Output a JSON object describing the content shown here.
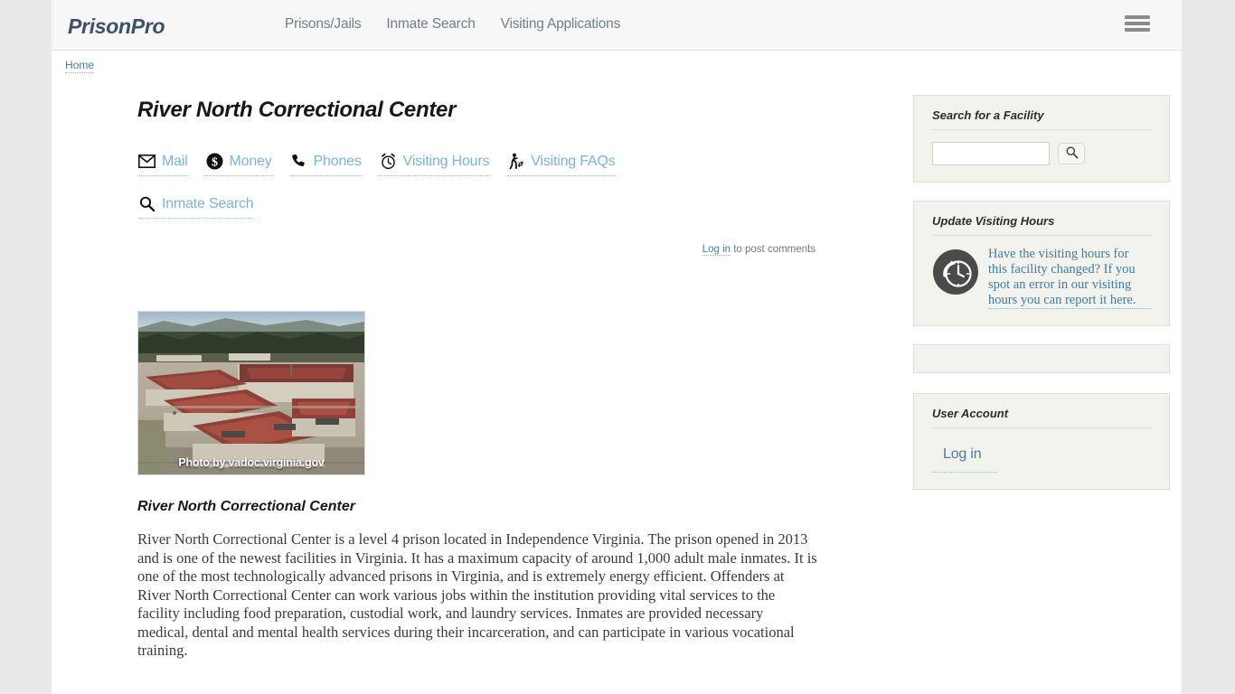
{
  "header": {
    "brand": "PrisonPro",
    "nav": [
      {
        "label": "Prisons/Jails"
      },
      {
        "label": "Inmate Search"
      },
      {
        "label": "Visiting Applications"
      }
    ],
    "menu_icon": "hamburger-icon"
  },
  "breadcrumb": {
    "home": "Home"
  },
  "main": {
    "title": "River North Correctional Center",
    "quick_links": [
      {
        "label": "Mail",
        "icon": "envelope-icon"
      },
      {
        "label": "Money",
        "icon": "dollar-circle-icon"
      },
      {
        "label": "Phones",
        "icon": "phone-icon"
      },
      {
        "label": "Visiting Hours",
        "icon": "alarm-clock-icon"
      },
      {
        "label": "Visiting FAQs",
        "icon": "walking-person-icon"
      },
      {
        "label": "Inmate Search",
        "icon": "magnifier-icon"
      }
    ],
    "comments": {
      "login_label": "Log in",
      "suffix": " to post comments"
    },
    "photo_caption": "Photo by vadoc.virginia.gov",
    "subtitle": "River North Correctional Center",
    "paragraph": "River North Correctional Center is a level 4 prison located in Independence Virginia.  The prison opened in 2013 and is one of the newest facilities in Virginia.  It has a maximum capacity of around 1,000 adult male inmates.  It is one of the most technologically advanced prisons in Virginia, and is extremely energy efficient.  Offenders at River North Correctional Center can work various jobs within the institution providing vital services to the facility including food preparation, custodial work, and laundry services.  Inmates are provided necessary medical, dental and mental health services during their incarceration, and can participate in various vocational training."
  },
  "sidebar": {
    "search_block": {
      "title": "Search for a Facility",
      "input_value": "",
      "input_placeholder": "",
      "button_icon": "magnifier-icon"
    },
    "update_block": {
      "title": "Update Visiting Hours",
      "icon": "clock-rewind-icon",
      "link_text": "Have the visiting hours for this facility changed?  If you spot an error in our visiting hours you can report it here."
    },
    "user_block": {
      "title": "User Account",
      "login_label": "Log in"
    }
  },
  "colors": {
    "page_bg": "#e9e9e9",
    "content_bg": "#ffffff",
    "header_bg": "#f7f7f7",
    "brand": "#3c5066",
    "nav_link": "#6d7f90",
    "accent_link": "#7ab3dd",
    "sidebar_block_bg": "#f3f3ee"
  }
}
